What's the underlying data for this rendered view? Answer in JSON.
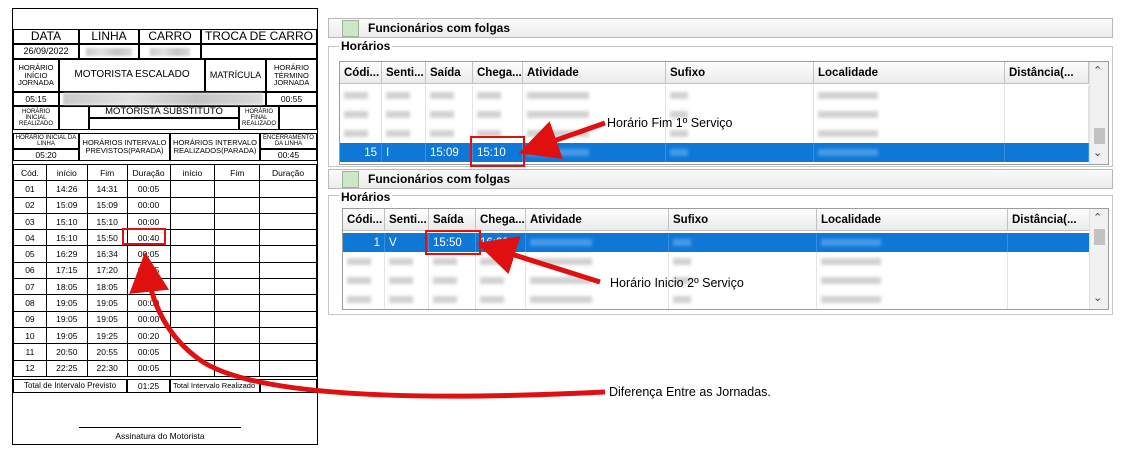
{
  "form": {
    "data_label": "DATA",
    "linha_label": "LINHA",
    "carro_label": "CARRO",
    "troca_label": "TROCA DE CARRO",
    "date_value": "26/09/2022",
    "horario_inicio_jornada": "HORÁRIO INÍCIO JORNADA",
    "motorista_escalado": "MOTORISTA   ESCALADO",
    "matricula": "MATRÍCULA",
    "horario_termino_jornada": "HORÁRIO TÉRMINO JORNADA",
    "inicio_value": "05:15",
    "termino_value": "00:55",
    "horario_inicial_realizado": "HORÁRIO INICIAL REALIZADO",
    "motorista_substituto": "MOTORISTA SUBSTITUTO",
    "horario_final_realizado": "HORÁRIO FINAL REALIZADO",
    "horario_inicial_linha": "HORÁRIO INICIAL DA LINHA",
    "horarios_intervalo_previstos": "HORÁRIOS INTERVALO PREVISTOS(PARADA)",
    "horarios_intervalo_realizados": "HORÁRIOS INTERVALO REALIZADOS(PARADA)",
    "encerramento_linha": "ENCERRAMENTO DA LINHA",
    "inicial_linha_value": "05:20",
    "encerramento_value": "00:45",
    "col_cod": "Cód.",
    "col_inicio": "início",
    "col_fim": "Fim",
    "col_duracao": "Duração",
    "col_inicio2": "início",
    "col_fim2": "Fim",
    "col_duracao2": "Duração",
    "rows": [
      {
        "cod": "01",
        "inicio": "14:26",
        "fim": "14:31",
        "dur": "00:05"
      },
      {
        "cod": "02",
        "inicio": "15:09",
        "fim": "15:09",
        "dur": "00:00"
      },
      {
        "cod": "03",
        "inicio": "15:10",
        "fim": "15:10",
        "dur": "00:00"
      },
      {
        "cod": "04",
        "inicio": "15:10",
        "fim": "15:50",
        "dur": "00:40"
      },
      {
        "cod": "05",
        "inicio": "16:29",
        "fim": "16:34",
        "dur": "00:05"
      },
      {
        "cod": "06",
        "inicio": "17:15",
        "fim": "17:20",
        "dur": "00:05"
      },
      {
        "cod": "07",
        "inicio": "18:05",
        "fim": "18:05",
        "dur": "00:00"
      },
      {
        "cod": "08",
        "inicio": "19:05",
        "fim": "19:05",
        "dur": "00:00"
      },
      {
        "cod": "09",
        "inicio": "19:05",
        "fim": "19:05",
        "dur": "00:00"
      },
      {
        "cod": "10",
        "inicio": "19:05",
        "fim": "19:25",
        "dur": "00:20"
      },
      {
        "cod": "11",
        "inicio": "20:50",
        "fim": "20:55",
        "dur": "00:05"
      },
      {
        "cod": "12",
        "inicio": "22:25",
        "fim": "22:30",
        "dur": "00:05"
      }
    ],
    "total_previsto_label": "Total de Intervalo Previsto",
    "total_previsto_value": "01:25",
    "total_realizado_label": "Total Intervalo Realizado",
    "assinatura": "Assinatura do Motorista"
  },
  "panel1": {
    "title": "Funcionários com folgas",
    "group": "Horários",
    "headers": [
      "Códi...",
      "Senti...",
      "Saída",
      "Chega...",
      "Atividade",
      "Sufixo",
      "Localidade",
      "Distância(..."
    ],
    "selected_row": {
      "cod": "15",
      "sentido": "I",
      "saida": "15:09",
      "chegada": "15:10"
    }
  },
  "panel2": {
    "title": "Funcionários com folgas",
    "group": "Horários",
    "headers": [
      "Códi...",
      "Senti...",
      "Saída",
      "Chega...",
      "Atividade",
      "Sufixo",
      "Localidade",
      "Distância(..."
    ],
    "selected_row": {
      "cod": "1",
      "sentido": "V",
      "saida": "15:50",
      "chegada": "16:29"
    }
  },
  "annotations": {
    "fim_primeiro": "Horário Fim 1º Serviço",
    "inicio_segundo": "Horário Inicio 2º Serviço",
    "diferenca": "Diferença Entre as Jornadas."
  },
  "colors": {
    "selection": "#0f78d7",
    "highlight": "#e01010"
  }
}
